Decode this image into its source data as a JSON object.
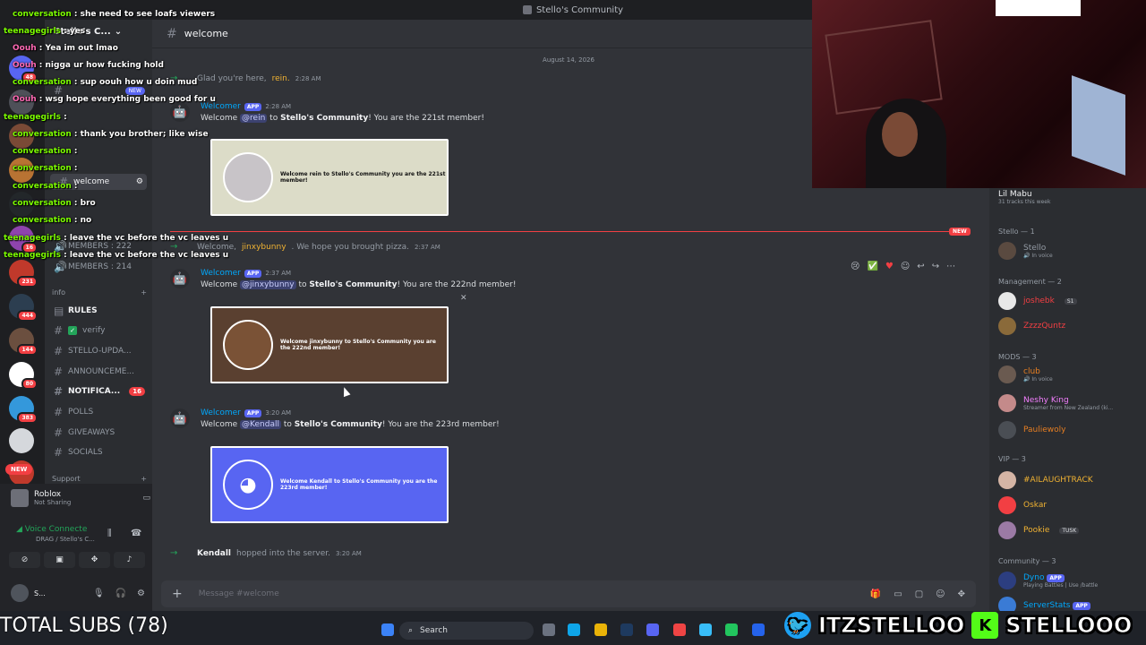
{
  "window": {
    "title": "Stello's Community"
  },
  "server": {
    "name": "Stello's C..."
  },
  "channel": {
    "name": "welcome",
    "composer_placeholder": "Message #welcome"
  },
  "sidebar": {
    "channels": [
      {
        "name": "welcome"
      },
      {
        "name": "MEMBERS : 222"
      },
      {
        "name": "MEMBERS : 214"
      }
    ],
    "category_info": "info",
    "info_channels": [
      {
        "name": "RULES"
      },
      {
        "name": "verify"
      },
      {
        "name": "STELLO-UPDA..."
      },
      {
        "name": "ANNOUNCEME..."
      },
      {
        "name": "NOTIFICA...",
        "badge": "16"
      },
      {
        "name": "POLLS"
      },
      {
        "name": "GIVEAWAYS"
      },
      {
        "name": "SOCIALS"
      }
    ],
    "category_support": "Support",
    "new_badge": "NEW"
  },
  "rail": {
    "new_label": "NEW"
  },
  "user_panel": {
    "activity_title": "Roblox",
    "activity_sub": "Not Sharing",
    "voice_status": "Voice Connecte",
    "voice_channel": "DRAG / Stello's C...",
    "username": "S..."
  },
  "messages": {
    "date": "August 14, 2026",
    "sys1": {
      "text": "Glad you're here,",
      "name": "rein.",
      "time": "2:28 AM"
    },
    "m1": {
      "author": "Welcomer",
      "badge": "APP",
      "time": "2:28 AM",
      "pre": "Welcome",
      "mention": "@rein",
      "mid": "to",
      "server": "Stello's Community",
      "post": "! You are the 221st member!",
      "card": "Welcome rein to Stello's Community you are the 221st member!"
    },
    "sys2": {
      "text": "Welcome,",
      "name": "jinxybunny",
      "rest": ". We hope you brought pizza.",
      "time": "2:37 AM"
    },
    "m2": {
      "author": "Welcomer",
      "badge": "APP",
      "time": "2:37 AM",
      "pre": "Welcome",
      "mention": "@jinxybunny",
      "mid": "to",
      "server": "Stello's Community",
      "post": "! You are the 222nd member!",
      "card": "Welcome jinxybunny to Stello's Community you are the 222nd member!"
    },
    "m3": {
      "author": "Welcomer",
      "badge": "APP",
      "time": "3:20 AM",
      "pre": "Welcome",
      "mention": "@Kendall",
      "mid": "to",
      "server": "Stello's Community",
      "post": "! You are the 223rd member!",
      "card": "Welcome Kendall to Stello's Community you are the 223rd member!"
    },
    "sys3": {
      "name": "Kendall",
      "text": "hopped into the server.",
      "time": "3:20 AM"
    },
    "new_label": "NEW"
  },
  "members": {
    "now_playing": {
      "name": "Lil Mabu",
      "sub": "31 tracks this week"
    },
    "groups": [
      {
        "label": "Stello — 1"
      },
      {
        "label": "Management — 2"
      },
      {
        "label": "MODS — 3"
      },
      {
        "label": "VIP — 3"
      },
      {
        "label": "Community — 3"
      }
    ],
    "list": [
      {
        "name": "Stello",
        "status": "In voice",
        "color": "#949ba4"
      },
      {
        "name": "joshebk",
        "tag": "S1",
        "color": "#f23f43"
      },
      {
        "name": "ZzzzQuntz",
        "color": "#f23f43"
      },
      {
        "name": "club",
        "status": "In voice",
        "color": "#e67e22"
      },
      {
        "name": "Neshy King",
        "status": "Streamer from New Zealand (ki...",
        "color": "#f47fff"
      },
      {
        "name": "Pauliewoly",
        "color": "#e67e22"
      },
      {
        "name": "#AILAUGHTRACK",
        "color": "#f0b232"
      },
      {
        "name": "Oskar",
        "color": "#f0b232"
      },
      {
        "name": "Pookie",
        "tag": "TUSK",
        "color": "#f0b232"
      },
      {
        "name": "Dyno",
        "badge": "APP",
        "status": "Playing Battles | Use /battle",
        "color": "#00a8fc"
      },
      {
        "name": "ServerStats",
        "badge": "APP",
        "color": "#00a8fc"
      }
    ]
  },
  "chat": [
    {
      "user": "conversation",
      "text": ": she need to see loafs viewers",
      "color": "#7cfc00"
    },
    {
      "user": "teenagegirls",
      "text": ": yes",
      "color": "#7cfc00"
    },
    {
      "user": "Oouh",
      "text": ": Yea im out lmao",
      "color": "#ff69b4"
    },
    {
      "user": "Oouh",
      "text": ": nigga ur how fucking hold",
      "color": "#ff69b4"
    },
    {
      "user": "conversation",
      "text": ": sup oouh how u doin mud",
      "color": "#7cfc00"
    },
    {
      "user": "Oouh",
      "text": ": wsg hope everything been good for u",
      "color": "#ff69b4"
    },
    {
      "user": "teenagegirls",
      "text": ":",
      "color": "#7cfc00"
    },
    {
      "user": "conversation",
      "text": ": thank you brother; like wise",
      "color": "#7cfc00"
    },
    {
      "user": "conversation",
      "text": ":",
      "color": "#7cfc00"
    },
    {
      "user": "conversation",
      "text": ":",
      "color": "#7cfc00"
    },
    {
      "user": "conversation",
      "text": ":",
      "color": "#7cfc00"
    },
    {
      "user": "conversation",
      "text": ": bro",
      "color": "#7cfc00"
    },
    {
      "user": "conversation",
      "text": ": no",
      "color": "#7cfc00"
    },
    {
      "user": "teenagegirls",
      "text": ": leave the vc before the vc leaves u",
      "color": "#7cfc00"
    },
    {
      "user": "teenagegirls",
      "text": ": leave the vc before the vc leaves u",
      "color": "#7cfc00"
    }
  ],
  "overlay": {
    "subs": "TOTAL SUBS (78)",
    "twitter": "ITZSTELLOO",
    "kick": "STELLOOO"
  },
  "taskbar": {
    "search": "Search"
  }
}
